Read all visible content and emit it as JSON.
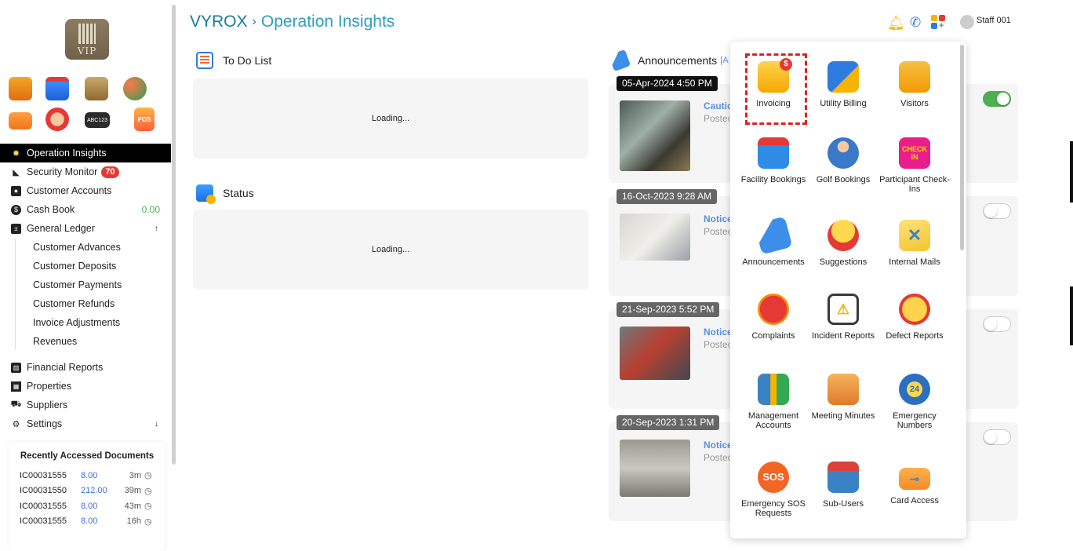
{
  "app": {
    "brand": "VYROX",
    "separator": "›",
    "page": "Operation Insights",
    "logo_text": "VIP"
  },
  "header": {
    "user": "Staff 001"
  },
  "quick_icons": [
    "building-icon",
    "calendar-icon",
    "bank-icon",
    "golf-icon",
    "card-icon",
    "face-scan-icon",
    "abc123-icon",
    "pos-icon"
  ],
  "sidebar": {
    "items": [
      {
        "label": "Operation Insights",
        "icon": "lightbulb-icon"
      },
      {
        "label": "Security Monitor",
        "icon": "cctv-icon",
        "badge": "70"
      },
      {
        "label": "Customer Accounts",
        "icon": "person-card-icon"
      },
      {
        "label": "Cash Book",
        "icon": "dollar-icon",
        "value": "0.00"
      },
      {
        "label": "General Ledger",
        "icon": "ledger-icon",
        "arrow": "↑"
      }
    ],
    "sub_items": [
      "Customer Advances",
      "Customer Deposits",
      "Customer Payments",
      "Customer Refunds",
      "Invoice Adjustments",
      "Revenues"
    ],
    "items2": [
      {
        "label": "Financial Reports",
        "icon": "report-icon"
      },
      {
        "label": "Properties",
        "icon": "building-small-icon"
      },
      {
        "label": "Suppliers",
        "icon": "truck-icon"
      },
      {
        "label": "Settings",
        "icon": "gear-icon",
        "arrow": "↓"
      }
    ]
  },
  "recent": {
    "title": "Recently Accessed Documents",
    "rows": [
      {
        "doc": "IC00031555",
        "amount": "8.00",
        "ago": "3m"
      },
      {
        "doc": "IC00031550",
        "amount": "212.00",
        "ago": "39m"
      },
      {
        "doc": "IC00031555",
        "amount": "8.00",
        "ago": "43m"
      },
      {
        "doc": "IC00031555",
        "amount": "8.00",
        "ago": "16h"
      }
    ]
  },
  "todo": {
    "title": "To Do List",
    "loading": "Loading..."
  },
  "status": {
    "title": "Status",
    "loading": "Loading..."
  },
  "announcements": {
    "title": "Announcements",
    "title_suffix": "[A",
    "cards": [
      {
        "date": "05-Apr-2024 4:50 PM",
        "title": "Cautic",
        "posted": "Postec",
        "enabled": true
      },
      {
        "date": "16-Oct-2023 9:28 AM",
        "title": "Notice",
        "posted": "Postec",
        "enabled": false
      },
      {
        "date": "21-Sep-2023 5:52 PM",
        "title": "Notice",
        "posted": "Postec",
        "enabled": false
      },
      {
        "date": "20-Sep-2023 1:31 PM",
        "title": "Notice",
        "posted": "Postec",
        "enabled": false
      }
    ]
  },
  "apps_menu": {
    "tiles": [
      {
        "label": "Invoicing",
        "icon": "invoice-icon",
        "color": "#f5b400"
      },
      {
        "label": "Utility Billing",
        "icon": "utility-billing-icon",
        "color": "#2f7be0"
      },
      {
        "label": "Visitors",
        "icon": "visitor-badge-icon",
        "color": "#f7a600"
      },
      {
        "label": "Facility Bookings",
        "icon": "calendar-icon",
        "color": "#2e8be6"
      },
      {
        "label": "Golf Bookings",
        "icon": "golfer-icon",
        "color": "#3a78c9"
      },
      {
        "label": "Participant Check-Ins",
        "icon": "check-in-icon",
        "color": "#e91e8c"
      },
      {
        "label": "Announcements",
        "icon": "megaphone-icon",
        "color": "#3d8ee8"
      },
      {
        "label": "Suggestions",
        "icon": "lightbulb-icon",
        "color": "#f2b705"
      },
      {
        "label": "Internal Mails",
        "icon": "envelope-icon",
        "color": "#f4c430"
      },
      {
        "label": "Complaints",
        "icon": "angry-face-icon",
        "color": "#e53935"
      },
      {
        "label": "Incident Reports",
        "icon": "clipboard-alert-icon",
        "color": "#3a9a5d"
      },
      {
        "label": "Defect Reports",
        "icon": "defect-badge-icon",
        "color": "#f59e0b"
      },
      {
        "label": "Management Accounts",
        "icon": "management-chart-icon",
        "color": "#3b82c4"
      },
      {
        "label": "Meeting Minutes",
        "icon": "meeting-icon",
        "color": "#e07b2a"
      },
      {
        "label": "Emergency Numbers",
        "icon": "phone-24-icon",
        "color": "#2c6fc2"
      },
      {
        "label": "Emergency SOS Requests",
        "icon": "sos-icon",
        "color": "#f26522"
      },
      {
        "label": "Sub-Users",
        "icon": "login-card-icon",
        "color": "#d9433b"
      },
      {
        "label": "Card Access",
        "icon": "key-card-icon",
        "color": "#f28c28"
      }
    ],
    "sos_text": "SOS",
    "checkin_text": "CHECK IN",
    "phone_text": "24"
  },
  "colors": {
    "accent": "#2f9dc0",
    "active_menu": "#000000",
    "toggle_on": "#4caf50",
    "badge": "#e53935"
  }
}
